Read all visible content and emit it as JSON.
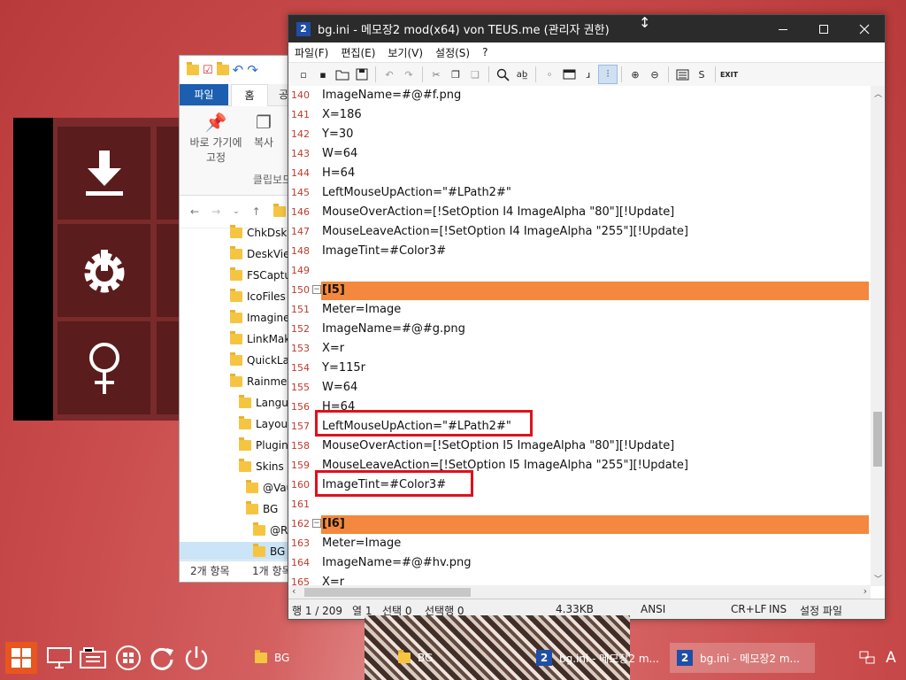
{
  "notepad": {
    "title": "bg.ini - 메모장2 mod(x64) von TEUS.me (관리자 권한)",
    "icon_text": "2",
    "menu": [
      "파일(F)",
      "편집(E)",
      "보기(V)",
      "설정(S)",
      "?"
    ],
    "toolbar_icons": [
      "new-file-icon",
      "new-window-icon",
      "open-folder-icon",
      "save-icon",
      "undo-icon",
      "redo-icon",
      "cut-icon",
      "copy-icon",
      "paste-icon",
      "find-icon",
      "replace-icon",
      "word-wrap-icon",
      "selection-icon",
      "long-lines-icon",
      "line-numbers-icon",
      "zoom-in-icon",
      "zoom-out-icon",
      "settings-icon",
      "scheme-icon",
      "exit-icon"
    ],
    "toolbar_labels": {
      "scheme": "S",
      "exit": "EXIT"
    },
    "lines": [
      {
        "n": "140",
        "text": "ImageName=#@#f.png"
      },
      {
        "n": "141",
        "text": "X=186"
      },
      {
        "n": "142",
        "text": "Y=30"
      },
      {
        "n": "143",
        "text": "W=64"
      },
      {
        "n": "144",
        "text": "H=64"
      },
      {
        "n": "145",
        "text": "LeftMouseUpAction=\"#LPath2#\""
      },
      {
        "n": "146",
        "text": "MouseOverAction=[!SetOption I4 ImageAlpha \"80\"][!Update]"
      },
      {
        "n": "147",
        "text": "MouseLeaveAction=[!SetOption I4 ImageAlpha \"255\"][!Update]"
      },
      {
        "n": "148",
        "text": "ImageTint=#Color3#"
      },
      {
        "n": "149",
        "text": ""
      },
      {
        "n": "150",
        "text": "[I5]"
      },
      {
        "n": "151",
        "text": "Meter=Image"
      },
      {
        "n": "152",
        "text": "ImageName=#@#g.png"
      },
      {
        "n": "153",
        "text": "X=r"
      },
      {
        "n": "154",
        "text": "Y=115r"
      },
      {
        "n": "155",
        "text": "W=64"
      },
      {
        "n": "156",
        "text": "H=64"
      },
      {
        "n": "157",
        "text": "LeftMouseUpAction=\"#LPath2#\""
      },
      {
        "n": "158",
        "text": "MouseOverAction=[!SetOption I5 ImageAlpha \"80\"][!Update]"
      },
      {
        "n": "159",
        "text": "MouseLeaveAction=[!SetOption I5 ImageAlpha \"255\"][!Update]"
      },
      {
        "n": "160",
        "text": "ImageTint=#Color3#"
      },
      {
        "n": "161",
        "text": ""
      },
      {
        "n": "162",
        "text": "[I6]"
      },
      {
        "n": "163",
        "text": "Meter=Image"
      },
      {
        "n": "164",
        "text": "ImageName=#@#hv.png"
      },
      {
        "n": "165",
        "text": "X=r"
      }
    ],
    "status": {
      "position": "행 1 / 209",
      "column": "열 1",
      "selection": "선택 0",
      "selected_lines": "선택행 0",
      "size": "4.33KB",
      "encoding": "ANSI",
      "eol": "CR+LF",
      "mode": "INS",
      "scheme": "설정 파일"
    },
    "colors": {
      "section_bar": "#f4883e",
      "highlight_box": "#e0101c",
      "line_number": "#c0392b"
    }
  },
  "explorer": {
    "tabs": [
      "파일",
      "홈",
      "공"
    ],
    "ribbon": {
      "pin_label_1": "바로 가기에",
      "pin_label_2": "고정",
      "copy_label": "복사",
      "group_label": "클립보드"
    },
    "tree": [
      {
        "label": "ChkDskG"
      },
      {
        "label": "DeskView"
      },
      {
        "label": "FSCaptu"
      },
      {
        "label": "IcoFiles"
      },
      {
        "label": "Imagine"
      },
      {
        "label": "LinkMak"
      },
      {
        "label": "QuickLa"
      },
      {
        "label": "Rainmet"
      },
      {
        "label": "Langua"
      },
      {
        "label": "Layout"
      },
      {
        "label": "Plugins"
      },
      {
        "label": "Skins"
      },
      {
        "label": "@Vau"
      },
      {
        "label": "BG"
      },
      {
        "label": "@Re"
      },
      {
        "label": "BG"
      }
    ],
    "status": {
      "items": "2개 항목",
      "selected": "1개 항목"
    }
  },
  "taskbar": {
    "tasks": [
      {
        "label": "BG"
      },
      {
        "label": "BG"
      },
      {
        "label": "bg.ini - 메모장2 m..."
      },
      {
        "label": "bg.ini - 메모장2 m..."
      }
    ],
    "ime": "A"
  }
}
